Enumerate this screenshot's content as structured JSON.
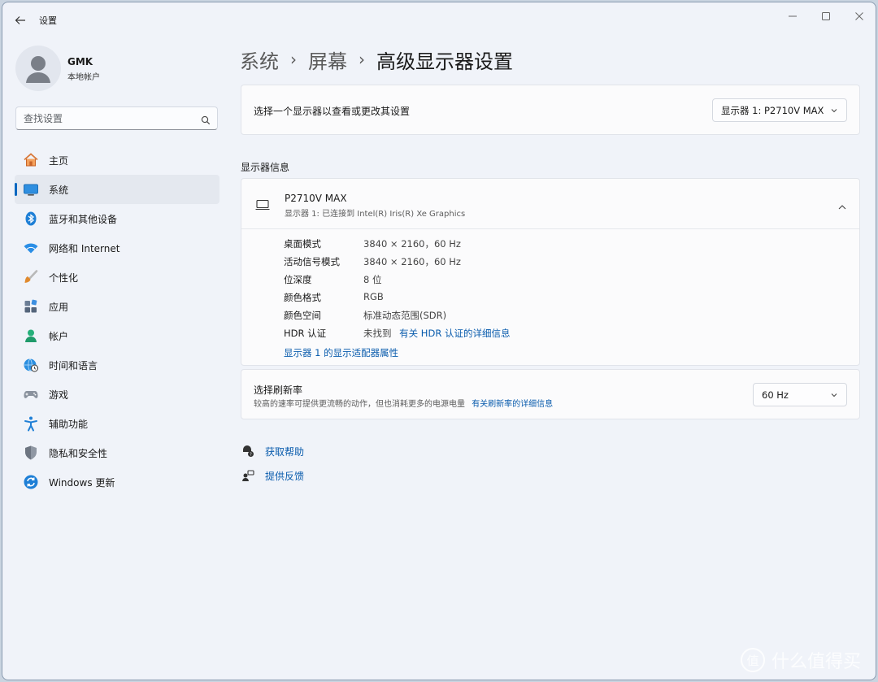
{
  "window": {
    "title": "设置"
  },
  "user": {
    "name": "GMK",
    "account_type": "本地帐户"
  },
  "search": {
    "placeholder": "查找设置"
  },
  "sidebar": {
    "items": [
      {
        "label": "主页",
        "icon": "home-icon"
      },
      {
        "label": "系统",
        "icon": "system-display-icon",
        "active": true
      },
      {
        "label": "蓝牙和其他设备",
        "icon": "bluetooth-icon"
      },
      {
        "label": "网络和 Internet",
        "icon": "wifi-icon"
      },
      {
        "label": "个性化",
        "icon": "brush-icon"
      },
      {
        "label": "应用",
        "icon": "apps-icon"
      },
      {
        "label": "帐户",
        "icon": "account-icon"
      },
      {
        "label": "时间和语言",
        "icon": "globe-clock-icon"
      },
      {
        "label": "游戏",
        "icon": "gamepad-icon"
      },
      {
        "label": "辅助功能",
        "icon": "accessibility-icon"
      },
      {
        "label": "隐私和安全性",
        "icon": "shield-icon"
      },
      {
        "label": "Windows 更新",
        "icon": "update-icon"
      }
    ]
  },
  "breadcrumb": {
    "items": [
      "系统",
      "屏幕",
      "高级显示器设置"
    ]
  },
  "display_select": {
    "label": "选择一个显示器以查看或更改其设置",
    "value": "显示器 1: P2710V MAX"
  },
  "display_info": {
    "section_title": "显示器信息",
    "monitor_name": "P2710V MAX",
    "monitor_desc": "显示器 1: 已连接到 Intel(R) Iris(R) Xe Graphics",
    "rows": [
      {
        "key": "桌面模式",
        "value": "3840 × 2160，60 Hz"
      },
      {
        "key": "活动信号模式",
        "value": "3840 × 2160，60 Hz"
      },
      {
        "key": "位深度",
        "value": "8 位"
      },
      {
        "key": "颜色格式",
        "value": "RGB"
      },
      {
        "key": "颜色空间",
        "value": "标准动态范围(SDR)"
      }
    ],
    "hdr": {
      "key": "HDR 认证",
      "value": "未找到",
      "link": "有关 HDR 认证的详细信息"
    },
    "adapter_link": "显示器 1 的显示适配器属性"
  },
  "refresh": {
    "title": "选择刷新率",
    "desc": "较高的速率可提供更流畅的动作，但也消耗更多的电源电量",
    "link": "有关刷新率的详细信息",
    "value": "60 Hz"
  },
  "help": {
    "get_help": "获取帮助",
    "feedback": "提供反馈"
  },
  "watermark": {
    "text": "什么值得买",
    "badge": "值"
  },
  "colors": {
    "accent": "#0067c0",
    "link": "#0a5cad",
    "background": "#f0f3f9"
  }
}
